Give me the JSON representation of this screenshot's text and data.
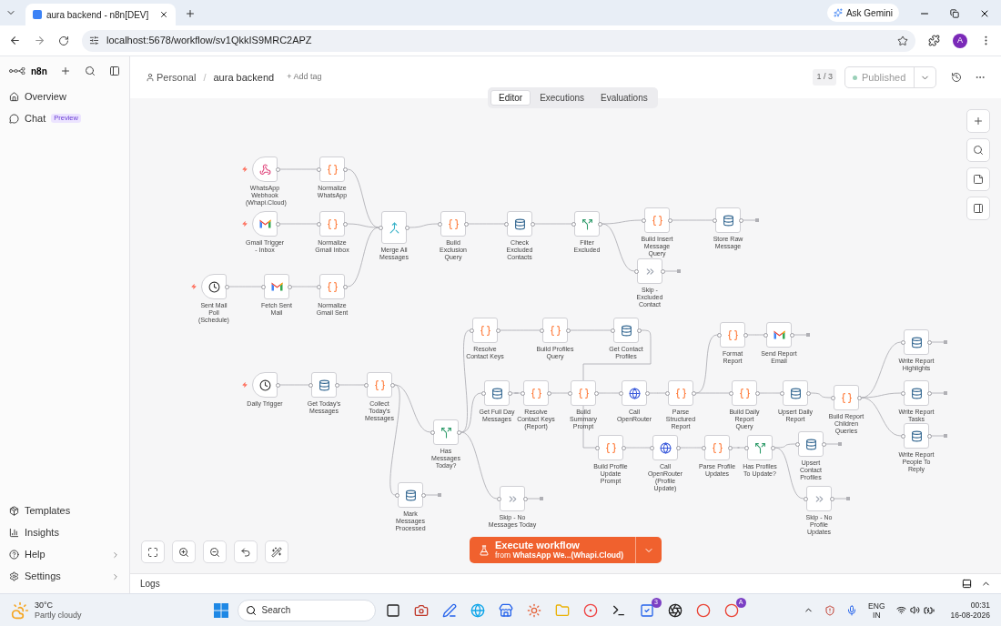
{
  "browser": {
    "tab_title": "aura backend - n8n[DEV]",
    "url": "localhost:5678/workflow/sv1QkkIS9MRC2APZ",
    "gemini_button": "Ask Gemini",
    "profile_initial": "A"
  },
  "sidebar": {
    "logo": "n8n",
    "items": [
      {
        "label": "Overview"
      },
      {
        "label": "Chat",
        "badge": "Preview"
      }
    ],
    "bottom_items": [
      {
        "label": "Templates",
        "expandable": false
      },
      {
        "label": "Insights",
        "expandable": false
      },
      {
        "label": "Help",
        "expandable": true
      },
      {
        "label": "Settings",
        "expandable": true
      }
    ]
  },
  "header": {
    "project": "Personal",
    "separator": "/",
    "workflow_name": "aura backend",
    "add_tag": "+ Add tag",
    "version": "1 / 3",
    "publish_status": "Published"
  },
  "tabs": [
    {
      "label": "Editor",
      "selected": true
    },
    {
      "label": "Executions",
      "selected": false
    },
    {
      "label": "Evaluations",
      "selected": false
    }
  ],
  "nodes": [
    {
      "label": "WhatsApp Webhook (Whapi.Cloud)",
      "kind": "webhook",
      "trigger": true
    },
    {
      "label": "Normalize WhatsApp",
      "kind": "code",
      "trigger": false
    },
    {
      "label": "Gmail Trigger - Inbox",
      "kind": "gmail",
      "trigger": true
    },
    {
      "label": "Normalize Gmail Inbox",
      "kind": "code",
      "trigger": false
    },
    {
      "label": "Sent Mail Poll (Schedule)",
      "kind": "schedule",
      "trigger": true
    },
    {
      "label": "Fetch Sent Mail",
      "kind": "gmail",
      "trigger": false
    },
    {
      "label": "Normalize Gmail Sent",
      "kind": "code",
      "trigger": false
    },
    {
      "label": "Merge All Messages",
      "kind": "merge",
      "trigger": false
    },
    {
      "label": "Build Exclusion Query",
      "kind": "code",
      "trigger": false
    },
    {
      "label": "Check Excluded Contacts",
      "kind": "postgres",
      "trigger": false
    },
    {
      "label": "Filter Excluded",
      "kind": "if",
      "trigger": false
    },
    {
      "label": "Build Insert Message Query",
      "kind": "code",
      "trigger": false
    },
    {
      "label": "Store Raw Message",
      "kind": "postgres",
      "trigger": false
    },
    {
      "label": "Skip - Excluded Contact",
      "kind": "skip",
      "trigger": false
    },
    {
      "label": "Daily Trigger",
      "kind": "schedule",
      "trigger": true
    },
    {
      "label": "Get Today's Messages",
      "kind": "postgres",
      "trigger": false
    },
    {
      "label": "Collect Today's Messages",
      "kind": "code",
      "trigger": false
    },
    {
      "label": "Has Messages Today?",
      "kind": "if",
      "trigger": false
    },
    {
      "label": "Resolve Contact Keys",
      "kind": "code",
      "trigger": false
    },
    {
      "label": "Build Profiles Query",
      "kind": "code",
      "trigger": false
    },
    {
      "label": "Get Contact Profiles",
      "kind": "postgres",
      "trigger": false
    },
    {
      "label": "Get Full Day Messages",
      "kind": "postgres",
      "trigger": false
    },
    {
      "label": "Resolve Contact Keys (Report)",
      "kind": "code",
      "trigger": false
    },
    {
      "label": "Build Summary Prompt",
      "kind": "code",
      "trigger": false
    },
    {
      "label": "Call OpenRouter",
      "kind": "http",
      "trigger": false
    },
    {
      "label": "Parse Structured Report",
      "kind": "code",
      "trigger": false
    },
    {
      "label": "Format Report",
      "kind": "code",
      "trigger": false
    },
    {
      "label": "Send Report Email",
      "kind": "gmail",
      "trigger": false
    },
    {
      "label": "Build Daily Report Query",
      "kind": "code",
      "trigger": false
    },
    {
      "label": "Upsert Daily Report",
      "kind": "postgres",
      "trigger": false
    },
    {
      "label": "Build Report Children Queries",
      "kind": "code",
      "trigger": false
    },
    {
      "label": "Write Report Highlights",
      "kind": "postgres",
      "trigger": false
    },
    {
      "label": "Write Report Tasks",
      "kind": "postgres",
      "trigger": false
    },
    {
      "label": "Write Report People To Reply",
      "kind": "postgres",
      "trigger": false
    },
    {
      "label": "Build Profile Update Prompt",
      "kind": "code",
      "trigger": false
    },
    {
      "label": "Call OpenRouter (Profile Update)",
      "kind": "http",
      "trigger": false
    },
    {
      "label": "Parse Profile Updates",
      "kind": "code",
      "trigger": false
    },
    {
      "label": "Has Profiles To Update?",
      "kind": "if",
      "trigger": false
    },
    {
      "label": "Upsert Contact Profiles",
      "kind": "postgres",
      "trigger": false
    },
    {
      "label": "Skip - No Profile Updates",
      "kind": "skip",
      "trigger": false
    },
    {
      "label": "Mark Messages Processed",
      "kind": "postgres",
      "trigger": false
    },
    {
      "label": "Skip - No Messages Today",
      "kind": "skip",
      "trigger": false
    }
  ],
  "execute_button": {
    "title": "Execute workflow",
    "subtitle": "from **WhatsApp We...(Whapi.Cloud)**"
  },
  "logs_panel": {
    "title": "Logs"
  },
  "taskbar": {
    "temperature": "30°C",
    "weather": "Partly cloudy",
    "search_placeholder": "Search",
    "language": "ENG",
    "region": "IN",
    "time": "00:31",
    "date": "16-08-2026",
    "apps": [
      {
        "kind": "taskview"
      },
      {
        "kind": "camera"
      },
      {
        "kind": "editor"
      },
      {
        "kind": "edge"
      },
      {
        "kind": "store"
      },
      {
        "kind": "spark"
      },
      {
        "kind": "files"
      },
      {
        "kind": "recorder"
      },
      {
        "kind": "terminal"
      },
      {
        "kind": "todo",
        "badge": "3"
      },
      {
        "kind": "aperture"
      },
      {
        "kind": "chrome"
      },
      {
        "kind": "chrome",
        "badge": "A"
      }
    ]
  }
}
